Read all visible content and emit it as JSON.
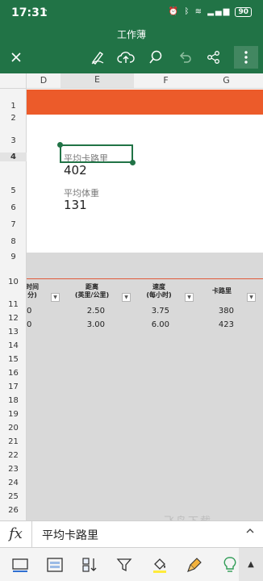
{
  "status": {
    "time": "17:31",
    "battery": "90"
  },
  "app": {
    "title": "工作薄"
  },
  "toolbar": [
    "close-icon",
    "pen-icon",
    "cloud-upload-icon",
    "search-icon",
    "undo-icon",
    "share-icon",
    "more-icon"
  ],
  "columns": [
    "D",
    "E",
    "F",
    "G"
  ],
  "rows": [
    "1",
    "2",
    "3",
    "4",
    "5",
    "6",
    "7",
    "8",
    "9",
    "10",
    "11",
    "12",
    "13",
    "14",
    "15",
    "16",
    "17",
    "18",
    "19",
    "20",
    "21",
    "22",
    "23",
    "24",
    "25",
    "26"
  ],
  "cards": {
    "calories_label": "平均卡路里",
    "calories_value": "402",
    "weight_label": "平均体重",
    "weight_value": "131"
  },
  "table": {
    "headers": [
      {
        "line1": "时间",
        "line2": "分)"
      },
      {
        "line1": "距离",
        "line2": "(英里/公里)"
      },
      {
        "line1": "速度",
        "line2": "(每小时)"
      },
      {
        "line1": "卡路里",
        "line2": ""
      }
    ],
    "rows": [
      [
        "0",
        "2.50",
        "3.75",
        "380"
      ],
      [
        "0",
        "3.00",
        "6.00",
        "423"
      ]
    ]
  },
  "formula_bar": {
    "fx": "fx",
    "value": "平均卡路里"
  },
  "watermark": "飞鸟下载",
  "bottom_toolbar": [
    "card-view-icon",
    "form-icon",
    "sort-icon",
    "filter-icon",
    "fill-color-icon",
    "format-painter-icon",
    "bulb-icon",
    "expand-up-icon"
  ],
  "colors": {
    "brand": "#217346",
    "accent_orange": "#ec5b2a",
    "fill_yellow": "#ffeb3b"
  }
}
